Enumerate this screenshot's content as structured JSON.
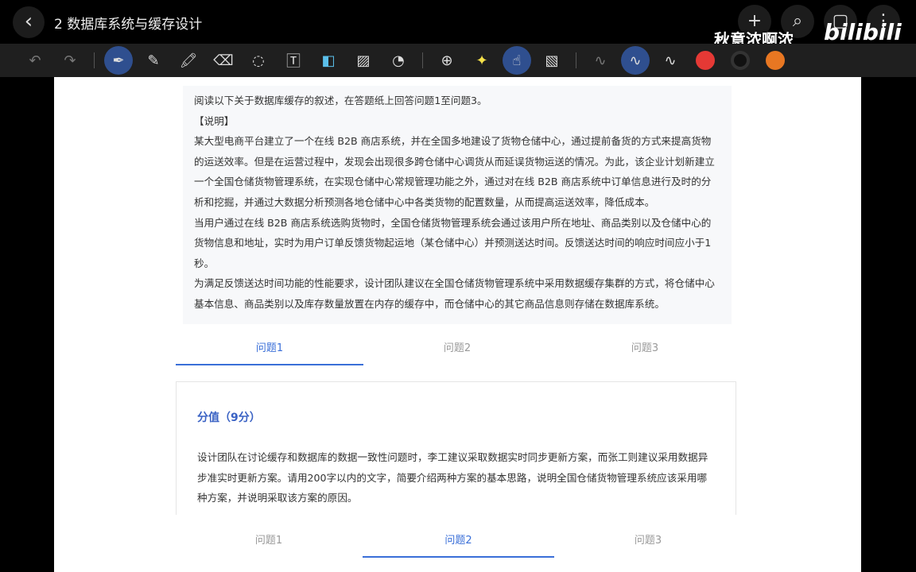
{
  "header": {
    "title": "2 数据库系统与缓存设计",
    "back_icon": "‹",
    "right_buttons": [
      "+",
      "⌕",
      "▢",
      "⋮"
    ]
  },
  "watermark": {
    "user": "秋意浓啊浓",
    "logo": "bilibili"
  },
  "toolbar": {
    "colors": [
      "#e53935",
      "#111111",
      "#e87722"
    ]
  },
  "intro": {
    "lines": [
      "阅读以下关于数据库缓存的叙述，在答题纸上回答问题1至问题3。",
      "【说明】",
      "某大型电商平台建立了一个在线 B2B 商店系统，并在全国多地建设了货物仓储中心，通过提前备货的方式来提高货物的运送效率。但是在运营过程中，发现会出现很多跨仓储中心调货从而延误货物运送的情况。为此，该企业计划新建立一个全国仓储货物管理系统，在实现仓储中心常规管理功能之外，通过对在线 B2B 商店系统中订单信息进行及时的分析和挖掘，并通过大数据分析预测各地仓储中心中各类货物的配置数量，从而提高运送效率，降低成本。",
      "当用户通过在线 B2B 商店系统选购货物时，全国仓储货物管理系统会通过该用户所在地址、商品类别以及仓储中心的货物信息和地址，实时为用户订单反馈货物起运地（某仓储中心）并预测送达时间。反馈送达时间的响应时间应小于1秒。",
      "为满足反馈送达时间功能的性能要求，设计团队建议在全国仓储货物管理系统中采用数据缓存集群的方式，将仓储中心基本信息、商品类别以及库存数量放置在内存的缓存中，而仓储中心的其它商品信息则存储在数据库系统。"
    ]
  },
  "tabs": [
    "问题1",
    "问题2",
    "问题3"
  ],
  "card": {
    "score": "分值（9分）",
    "question": "设计团队在讨论缓存和数据库的数据一致性问题时，李工建议采取数据实时同步更新方案，而张工则建议采用数据异步准实时更新方案。请用200字以内的文字，简要介绍两种方案的基本思路，说明全国仓储货物管理系统应该采用哪种方案，并说明采取该方案的原因。"
  }
}
